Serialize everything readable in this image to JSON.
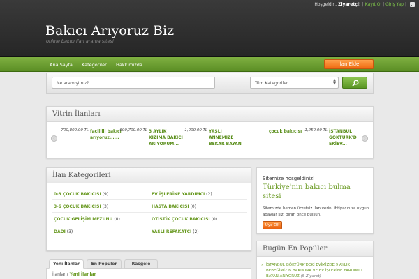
{
  "header": {
    "greeting": "Hoşgeldin,",
    "user": "Ziyaretçi!",
    "register": "Kayıt Ol",
    "separator": "|",
    "login": "Giriş Yap",
    "site_title": "Bakıcı Arıyoruz Biz",
    "slogan": "online bakıcı ilan arama sitesi"
  },
  "nav": {
    "items": [
      "Ana Sayfa",
      "Kategoriler",
      "Hakkımızda"
    ],
    "cta": "İlan Ekle"
  },
  "search": {
    "placeholder": "Ne aramıştınız?",
    "category": "Tüm Kategoriler"
  },
  "vitrin": {
    "title": "Vitrin İlanları",
    "listings": [
      {
        "price": "700,800.00 TL",
        "name": "facilllll bakıcı arıyoruz......"
      },
      {
        "price": "600,700.00 TL",
        "name": "3 AYLIK KIZIMA BAKICI ARIYORUM..."
      },
      {
        "price": "1,000.00 TL",
        "name": "YAŞLI ANNEMİZE BEKAR BAYAN"
      },
      {
        "price": "",
        "name": "çocuk bakıcısı"
      },
      {
        "price": "1,250.00 TL",
        "name": "İSTANBUL GÖKTÜRK'D EKİEV..."
      }
    ]
  },
  "categories": {
    "title": "İlan Kategorileri",
    "items": [
      {
        "name": "0-3 ÇOCUK BAKICISI",
        "count": "(9)"
      },
      {
        "name": "EV İŞLERİNE YARDIMCI",
        "count": "(2)"
      },
      {
        "name": "3-6 ÇOCUK BAKICISI",
        "count": "(3)"
      },
      {
        "name": "HASTA BAKICISI",
        "count": "(0)"
      },
      {
        "name": "ÇOCUK GELİŞİM MEZUNU",
        "count": "(0)"
      },
      {
        "name": "OTİSTİK ÇOCUK BAKICISI",
        "count": "(0)"
      },
      {
        "name": "DADI",
        "count": "(3)"
      },
      {
        "name": "YAŞLI REFAKATÇI",
        "count": "(2)"
      }
    ]
  },
  "welcome": {
    "line1": "Sitemize hoşgeldiniz!",
    "headline": "Türkiye'nin bakıcı bulma sitesi",
    "text": "Sitemizde hemen ücretsiz ilan verin, ihtiyacınıza uygun adaylar sizi biran önce bulsun.",
    "button": "Üye Ol!"
  },
  "popular": {
    "title": "Bugün En Popüler",
    "item": "İSTANBUL GÖKTÜRK'DEKİ EVİMİZDE 9 AYLIK BEBEĞİMİZİN BAKIMINA VE EV İŞLERİNE YARDIMCI BAYAN ARIYORUZ",
    "views": "(5 Ziyaret)"
  },
  "tabs": {
    "items": [
      "Yeni İlanlar",
      "En Popüler",
      "Rasgele"
    ],
    "breadcrumb_root": "İlanlar",
    "breadcrumb_sep": "/",
    "breadcrumb_current": "Yeni İlanlar"
  },
  "colors": {
    "nav_green": "#6a9f33",
    "accent_orange": "#f27a1a",
    "link_green": "#6a9a23"
  }
}
